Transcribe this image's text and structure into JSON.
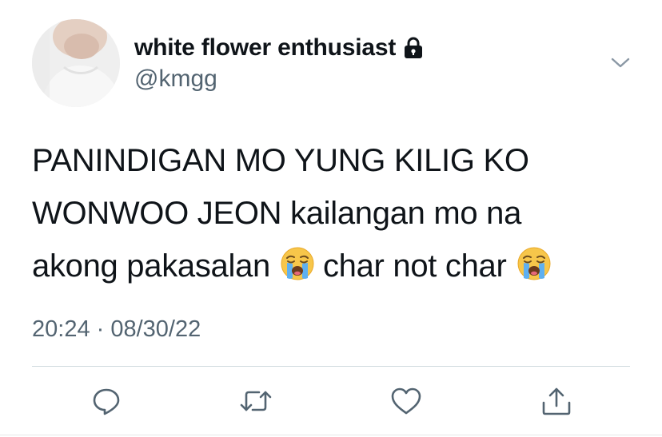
{
  "author": {
    "display_name": "white flower enthusiast",
    "handle": "@kmgg",
    "protected_icon": "lock-icon",
    "avatar": "profile-photo"
  },
  "menu_icon": "chevron-down-icon",
  "tweet": {
    "line1": "PANINDIGAN MO YUNG KILIG KO",
    "line2": "WONWOO JEON kailangan mo na",
    "line3_a": "akong pakasalan",
    "line3_b": "char not char",
    "emoji": "loudly-crying-face-emoji"
  },
  "timestamp": "20:24 · 08/30/22",
  "actions": [
    "reply-icon",
    "retweet-icon",
    "like-icon",
    "share-icon"
  ],
  "colors": {
    "text": "#0f1419",
    "secondary": "#536471",
    "divider": "#cfd9de"
  }
}
